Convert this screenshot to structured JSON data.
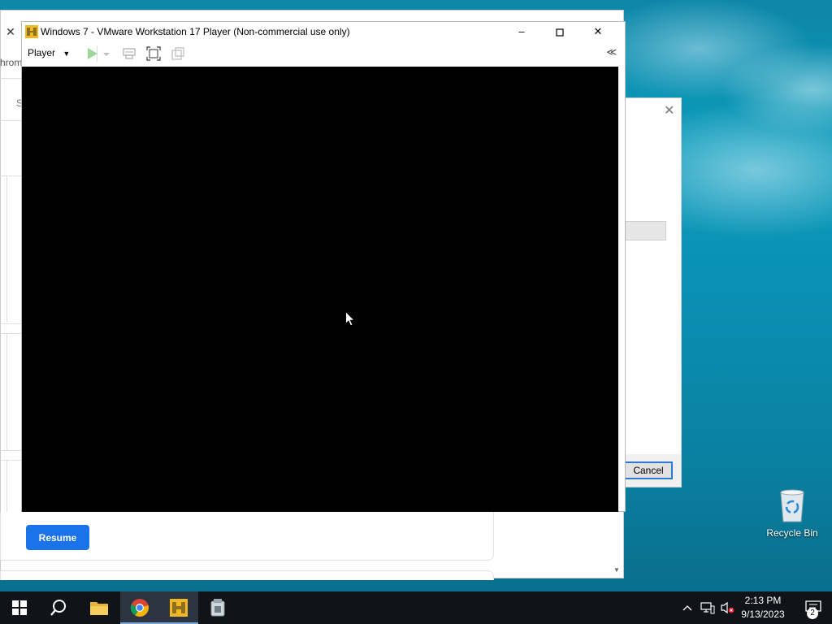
{
  "vmware": {
    "title": "Windows 7 - VMware Workstation 17 Player (Non-commercial use only)",
    "player_menu_label": "Player",
    "collapse_glyph": "≪"
  },
  "background_browser": {
    "chrome_text": "hrom",
    "s_text": "S",
    "resume_label": "Resume"
  },
  "dialog": {
    "cancel_label": "Cancel"
  },
  "desktop": {
    "recycle_bin_label": "Recycle Bin"
  },
  "taskbar": {
    "time": "2:13 PM",
    "date": "9/13/2023",
    "notification_count": "2"
  },
  "icons": [
    "windows-start-icon",
    "search-icon",
    "file-explorer-icon",
    "chrome-icon",
    "vmware-icon",
    "installer-icon",
    "chevron-up-icon",
    "network-icon",
    "volume-muted-icon",
    "notifications-icon",
    "recycle-bin-icon"
  ]
}
